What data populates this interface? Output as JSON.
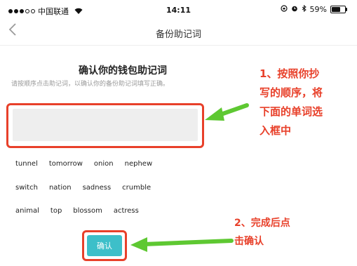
{
  "status_bar": {
    "carrier": "中国联通",
    "time": "14:11",
    "battery": "59%",
    "battery_level": 0.59
  },
  "nav": {
    "back_icon": "chevron-left-icon",
    "title": "备份助记词"
  },
  "content": {
    "heading": "确认你的钱包助记词",
    "instruction": "请按顺序点击助记词，以确认你的备份助记词填写正确。",
    "words": [
      [
        "tunnel",
        "tomorrow",
        "onion",
        "nephew"
      ],
      [
        "switch",
        "nation",
        "sadness",
        "crumble"
      ],
      [
        "animal",
        "top",
        "blossom",
        "actress"
      ]
    ],
    "confirm_label": "确认"
  },
  "annotations": {
    "step1_lines": [
      "1、按照你抄",
      "写的顺序，将",
      "下面的单词选",
      "入框中"
    ],
    "step2_lines": [
      "2、完成后点",
      "击确认"
    ]
  },
  "colors": {
    "accent": "#3dbfc9",
    "annotation": "#e8402a",
    "arrow": "#5ec832"
  }
}
